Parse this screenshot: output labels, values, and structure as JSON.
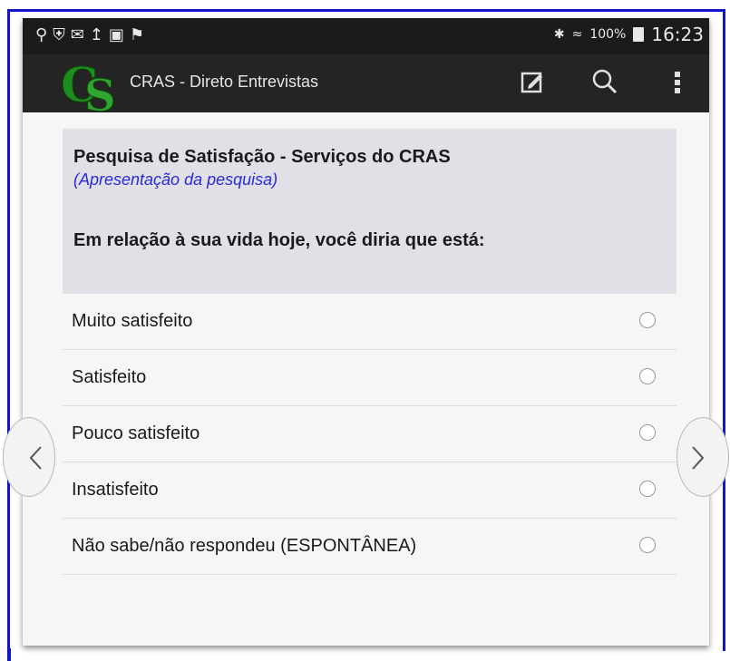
{
  "status_bar": {
    "battery": "100%",
    "time": "16:23",
    "left_icons": [
      "usb-icon",
      "shield-icon",
      "mail-icon",
      "upload-icon",
      "image-icon",
      "flag-icon"
    ],
    "right_icons": [
      "bluetooth-icon",
      "wifi-icon",
      "battery-icon"
    ]
  },
  "action_bar": {
    "logo_text": "CS",
    "title": "CRAS - Direto Entrevistas",
    "actions": [
      "edit-icon",
      "search-icon",
      "overflow-menu-icon"
    ]
  },
  "question": {
    "title": "Pesquisa de Satisfação - Serviços do CRAS",
    "subtitle": "(Apresentação da pesquisa)",
    "text": "Em relação à sua vida hoje, você diria que está:"
  },
  "options": [
    {
      "label": "Muito satisfeito",
      "selected": false
    },
    {
      "label": "Satisfeito",
      "selected": false
    },
    {
      "label": "Pouco satisfeito",
      "selected": false
    },
    {
      "label": "Insatisfeito",
      "selected": false
    },
    {
      "label": "Não sabe/não respondeu (ESPONTÂNEA)",
      "selected": false
    }
  ],
  "navigation": {
    "prev": "previous-arrow-icon",
    "next": "next-arrow-icon"
  },
  "colors": {
    "frame": "#1414c8",
    "action_bar": "#242424",
    "question_bg": "#e0e0e6",
    "subtitle": "#2a2adc",
    "logo_green": "#1e8c1e"
  }
}
